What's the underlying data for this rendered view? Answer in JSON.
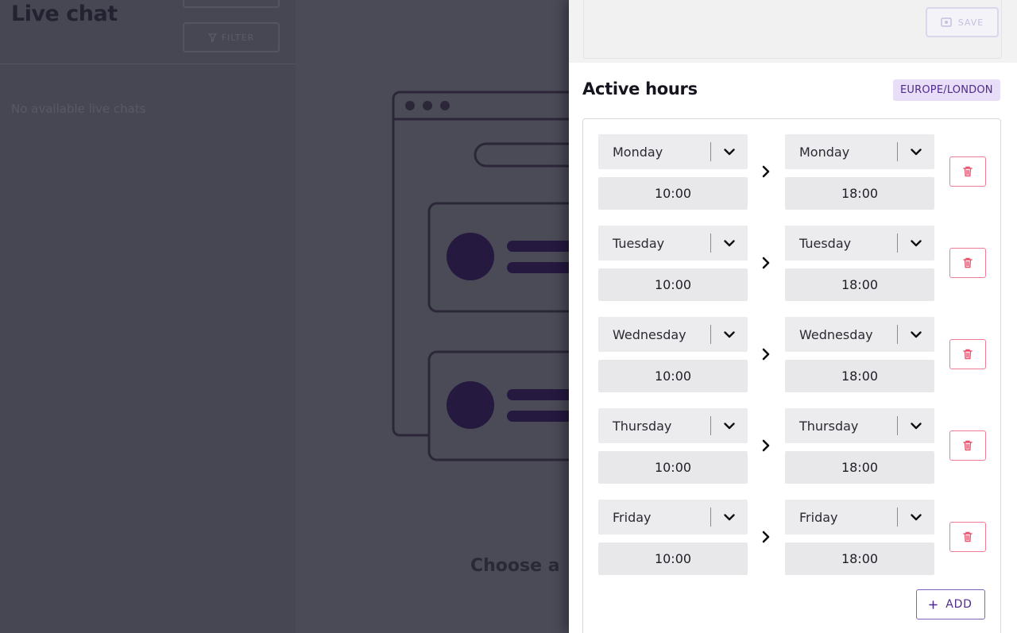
{
  "background": {
    "title": "Live chat",
    "filter_label": "FILTER",
    "empty_message": "No available live chats",
    "choose_text": "Choose a"
  },
  "panel": {
    "save_label": "SAVE",
    "section_title": "Active hours",
    "timezone": "EUROPE/LONDON",
    "add_label": "ADD",
    "rows": [
      {
        "start_day": "Monday",
        "start_time": "10:00",
        "end_day": "Monday",
        "end_time": "18:00"
      },
      {
        "start_day": "Tuesday",
        "start_time": "10:00",
        "end_day": "Tuesday",
        "end_time": "18:00"
      },
      {
        "start_day": "Wednesday",
        "start_time": "10:00",
        "end_day": "Wednesday",
        "end_time": "18:00"
      },
      {
        "start_day": "Thursday",
        "start_time": "10:00",
        "end_day": "Thursday",
        "end_time": "18:00"
      },
      {
        "start_day": "Friday",
        "start_time": "10:00",
        "end_day": "Friday",
        "end_time": "18:00"
      }
    ]
  },
  "colors": {
    "accent": "#4f2a8c",
    "badge_bg": "#e8def8",
    "delete": "#e8546f"
  }
}
